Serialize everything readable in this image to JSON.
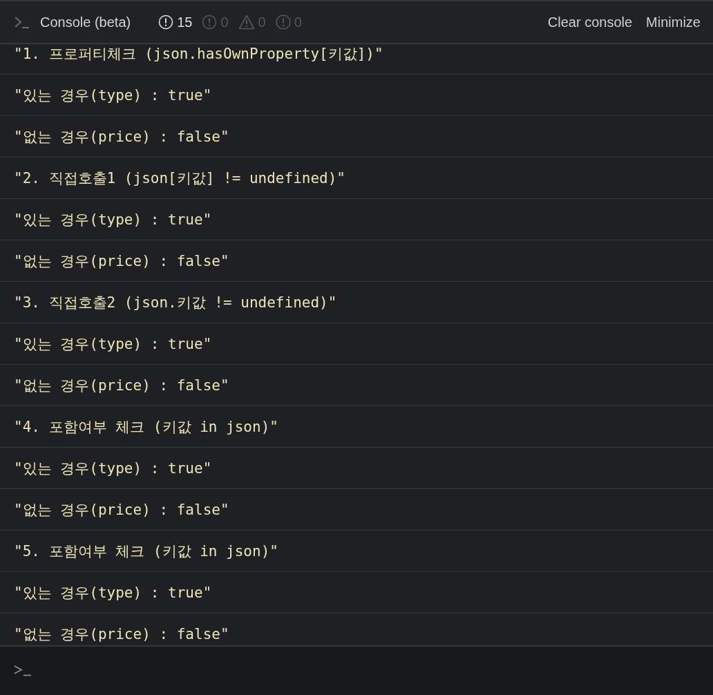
{
  "header": {
    "title": "Console (beta)",
    "counters": [
      {
        "kind": "info",
        "count": "15",
        "active": true
      },
      {
        "kind": "error",
        "count": "0",
        "active": false
      },
      {
        "kind": "warning",
        "count": "0",
        "active": false
      },
      {
        "kind": "debug",
        "count": "0",
        "active": false
      }
    ],
    "actions": [
      "Clear console",
      "Minimize"
    ]
  },
  "log": [
    "\"1. 프로퍼티체크 (json.hasOwnProperty[키값])\"",
    "\"있는 경우(type) : true\"",
    "\"없는 경우(price) : false\"",
    "\"2. 직접호출1 (json[키값] != undefined)\"",
    "\"있는 경우(type) : true\"",
    "\"없는 경우(price) : false\"",
    "\"3. 직접호출2 (json.키값 != undefined)\"",
    "\"있는 경우(type) : true\"",
    "\"없는 경우(price) : false\"",
    "\"4. 포함여부 체크 (키값 in json)\"",
    "\"있는 경우(type) : true\"",
    "\"없는 경우(price) : false\"",
    "\"5. 포함여부 체크 (키값 in json)\"",
    "\"있는 경우(type) : true\"",
    "\"없는 경우(price) : false\""
  ]
}
